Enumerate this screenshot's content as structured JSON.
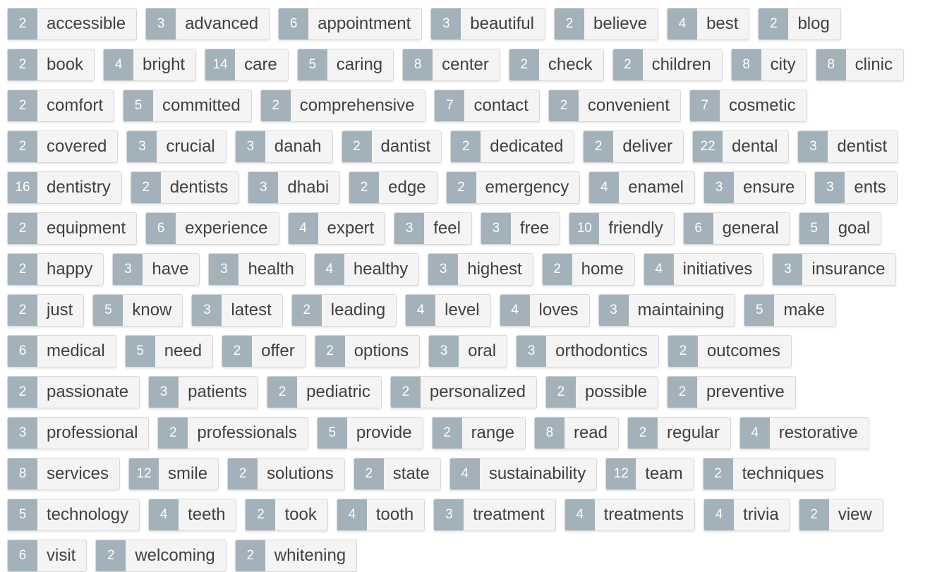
{
  "tag_cloud": {
    "rows": [
      [
        {
          "count": "2",
          "word": "accessible"
        },
        {
          "count": "3",
          "word": "advanced"
        },
        {
          "count": "6",
          "word": "appointment"
        },
        {
          "count": "3",
          "word": "beautiful"
        },
        {
          "count": "2",
          "word": "believe"
        },
        {
          "count": "4",
          "word": "best"
        },
        {
          "count": "2",
          "word": "blog"
        }
      ],
      [
        {
          "count": "2",
          "word": "book"
        },
        {
          "count": "4",
          "word": "bright"
        },
        {
          "count": "14",
          "word": "care"
        },
        {
          "count": "5",
          "word": "caring"
        },
        {
          "count": "8",
          "word": "center"
        },
        {
          "count": "2",
          "word": "check"
        },
        {
          "count": "2",
          "word": "children"
        },
        {
          "count": "8",
          "word": "city"
        },
        {
          "count": "8",
          "word": "clinic"
        }
      ],
      [
        {
          "count": "2",
          "word": "comfort"
        },
        {
          "count": "5",
          "word": "committed"
        },
        {
          "count": "2",
          "word": "comprehensive"
        },
        {
          "count": "7",
          "word": "contact"
        },
        {
          "count": "2",
          "word": "convenient"
        },
        {
          "count": "7",
          "word": "cosmetic"
        }
      ],
      [
        {
          "count": "2",
          "word": "covered"
        },
        {
          "count": "3",
          "word": "crucial"
        },
        {
          "count": "3",
          "word": "danah"
        },
        {
          "count": "2",
          "word": "dantist"
        },
        {
          "count": "2",
          "word": "dedicated"
        },
        {
          "count": "2",
          "word": "deliver"
        },
        {
          "count": "22",
          "word": "dental"
        },
        {
          "count": "3",
          "word": "dentist"
        }
      ],
      [
        {
          "count": "16",
          "word": "dentistry"
        },
        {
          "count": "2",
          "word": "dentists"
        },
        {
          "count": "3",
          "word": "dhabi"
        },
        {
          "count": "2",
          "word": "edge"
        },
        {
          "count": "2",
          "word": "emergency"
        },
        {
          "count": "4",
          "word": "enamel"
        },
        {
          "count": "3",
          "word": "ensure"
        },
        {
          "count": "3",
          "word": "ents"
        }
      ],
      [
        {
          "count": "2",
          "word": "equipment"
        },
        {
          "count": "6",
          "word": "experience"
        },
        {
          "count": "4",
          "word": "expert"
        },
        {
          "count": "3",
          "word": "feel"
        },
        {
          "count": "3",
          "word": "free"
        },
        {
          "count": "10",
          "word": "friendly"
        },
        {
          "count": "6",
          "word": "general"
        },
        {
          "count": "5",
          "word": "goal"
        }
      ],
      [
        {
          "count": "2",
          "word": "happy"
        },
        {
          "count": "3",
          "word": "have"
        },
        {
          "count": "3",
          "word": "health"
        },
        {
          "count": "4",
          "word": "healthy"
        },
        {
          "count": "3",
          "word": "highest"
        },
        {
          "count": "2",
          "word": "home"
        },
        {
          "count": "4",
          "word": "initiatives"
        },
        {
          "count": "3",
          "word": "insurance"
        }
      ],
      [
        {
          "count": "2",
          "word": "just"
        },
        {
          "count": "5",
          "word": "know"
        },
        {
          "count": "3",
          "word": "latest"
        },
        {
          "count": "2",
          "word": "leading"
        },
        {
          "count": "4",
          "word": "level"
        },
        {
          "count": "4",
          "word": "loves"
        },
        {
          "count": "3",
          "word": "maintaining"
        },
        {
          "count": "5",
          "word": "make"
        }
      ],
      [
        {
          "count": "6",
          "word": "medical"
        },
        {
          "count": "5",
          "word": "need"
        },
        {
          "count": "2",
          "word": "offer"
        },
        {
          "count": "2",
          "word": "options"
        },
        {
          "count": "3",
          "word": "oral"
        },
        {
          "count": "3",
          "word": "orthodontics"
        },
        {
          "count": "2",
          "word": "outcomes"
        }
      ],
      [
        {
          "count": "2",
          "word": "passionate"
        },
        {
          "count": "3",
          "word": "patients"
        },
        {
          "count": "2",
          "word": "pediatric"
        },
        {
          "count": "2",
          "word": "personalized"
        },
        {
          "count": "2",
          "word": "possible"
        },
        {
          "count": "2",
          "word": "preventive"
        }
      ],
      [
        {
          "count": "3",
          "word": "professional"
        },
        {
          "count": "2",
          "word": "professionals"
        },
        {
          "count": "5",
          "word": "provide"
        },
        {
          "count": "2",
          "word": "range"
        },
        {
          "count": "8",
          "word": "read"
        },
        {
          "count": "2",
          "word": "regular"
        },
        {
          "count": "4",
          "word": "restorative"
        }
      ],
      [
        {
          "count": "8",
          "word": "services"
        },
        {
          "count": "12",
          "word": "smile"
        },
        {
          "count": "2",
          "word": "solutions"
        },
        {
          "count": "2",
          "word": "state"
        },
        {
          "count": "4",
          "word": "sustainability"
        },
        {
          "count": "12",
          "word": "team"
        },
        {
          "count": "2",
          "word": "techniques"
        }
      ],
      [
        {
          "count": "5",
          "word": "technology"
        },
        {
          "count": "4",
          "word": "teeth"
        },
        {
          "count": "2",
          "word": "took"
        },
        {
          "count": "4",
          "word": "tooth"
        },
        {
          "count": "3",
          "word": "treatment"
        },
        {
          "count": "4",
          "word": "treatments"
        },
        {
          "count": "4",
          "word": "trivia"
        },
        {
          "count": "2",
          "word": "view"
        }
      ],
      [
        {
          "count": "6",
          "word": "visit"
        },
        {
          "count": "2",
          "word": "welcoming"
        },
        {
          "count": "2",
          "word": "whitening"
        }
      ]
    ]
  }
}
